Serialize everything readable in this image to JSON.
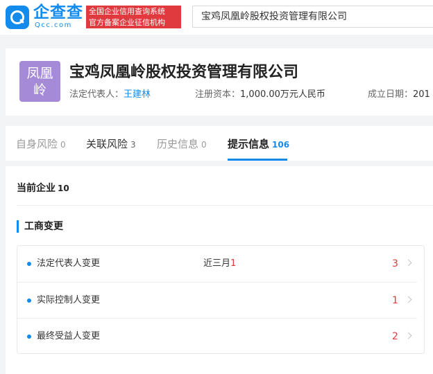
{
  "header": {
    "logo_name": "企查查",
    "logo_domain": "Qcc.com",
    "cert_line1": "全国企业信用查询系统",
    "cert_line2": "官方备案企业征信机构",
    "search_value": "宝鸡凤凰岭股权投资管理有限公司"
  },
  "company": {
    "avatar_line1": "凤凰",
    "avatar_line2": "岭",
    "name": "宝鸡凤凰岭股权投资管理有限公司",
    "legal_rep_label": "法定代表人：",
    "legal_rep_value": "王建林",
    "capital_label": "注册资本：",
    "capital_value": "1,000.00万元人民币",
    "founded_label": "成立日期：",
    "founded_value": "201"
  },
  "tabs": [
    {
      "label": "自身风险",
      "count": "0"
    },
    {
      "label": "关联风险",
      "count": "3"
    },
    {
      "label": "历史信息",
      "count": "0"
    },
    {
      "label": "提示信息",
      "count": "106"
    }
  ],
  "content": {
    "current_label": "当前企业",
    "current_count": "10",
    "section_title": "工商变更",
    "rows": [
      {
        "label": "法定代表人变更",
        "recent_prefix": "近三月",
        "recent_count": "1",
        "count": "3"
      },
      {
        "label": "实际控制人变更",
        "recent_prefix": "",
        "recent_count": "",
        "count": "1"
      },
      {
        "label": "最终受益人变更",
        "recent_prefix": "",
        "recent_count": "",
        "count": "2"
      }
    ]
  },
  "colors": {
    "brand": "#128bed",
    "alert": "#e0393e",
    "avatar": "#a58ad8"
  }
}
